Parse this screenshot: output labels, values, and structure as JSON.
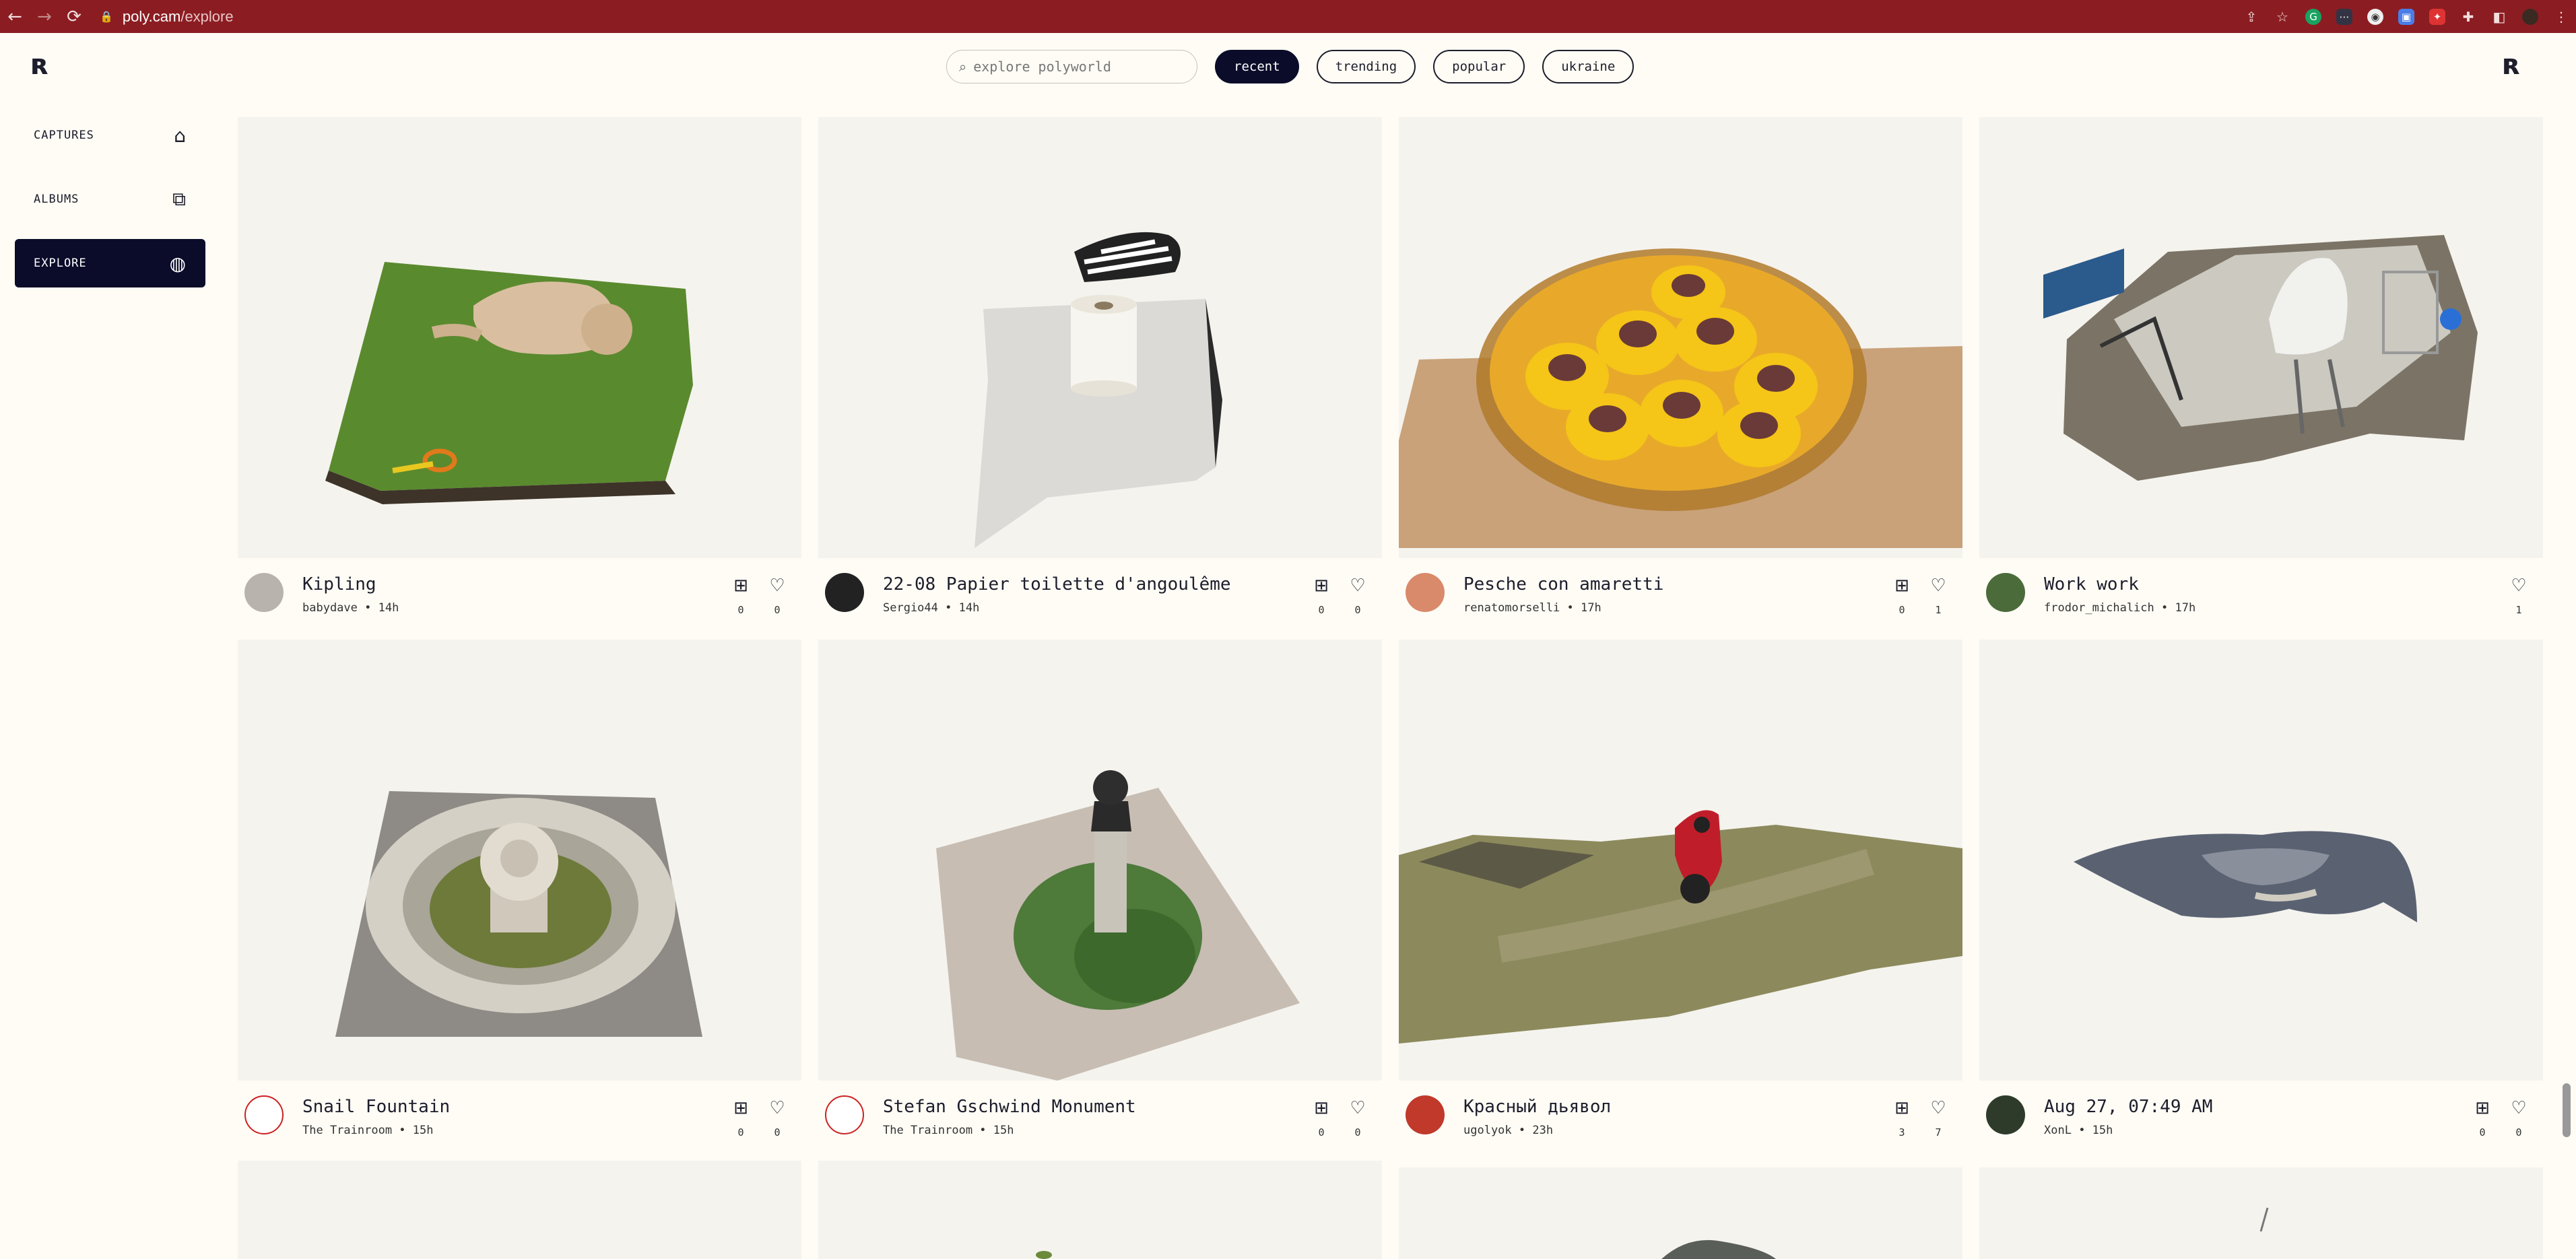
{
  "browser": {
    "url_host": "poly.cam",
    "url_path": "/explore",
    "back": "←",
    "forward": "→",
    "reload": "⟳"
  },
  "nav": {
    "captures": "CAPTURES",
    "albums": "ALBUMS",
    "explore": "EXPLORE"
  },
  "search": {
    "placeholder": "explore polyworld"
  },
  "filters": [
    "recent",
    "trending",
    "popular",
    "ukraine"
  ],
  "cards": [
    {
      "title": "Kipling",
      "author": "babydave",
      "time": "14h",
      "saves": "0",
      "likes": "0"
    },
    {
      "title": "22-08 Papier toilette d'angoulême",
      "author": "Sergio44",
      "time": "14h",
      "saves": "0",
      "likes": "0"
    },
    {
      "title": "Pesche con amaretti",
      "author": "renatomorselli",
      "time": "17h",
      "saves": "0",
      "likes": "1"
    },
    {
      "title": "Work work",
      "author": "frodor_michalich",
      "time": "17h",
      "likes": "1"
    },
    {
      "title": "Snail Fountain",
      "author": "The Trainroom",
      "time": "15h",
      "saves": "0",
      "likes": "0"
    },
    {
      "title": "Stefan Gschwind Monument",
      "author": "The Trainroom",
      "time": "15h",
      "saves": "0",
      "likes": "0"
    },
    {
      "title": "Красный дьявол",
      "author": "ugolyok",
      "time": "23h",
      "saves": "3",
      "likes": "7"
    },
    {
      "title": "Aug 27, 07:49 AM",
      "author": "XonL",
      "time": "15h",
      "saves": "0",
      "likes": "0"
    }
  ]
}
